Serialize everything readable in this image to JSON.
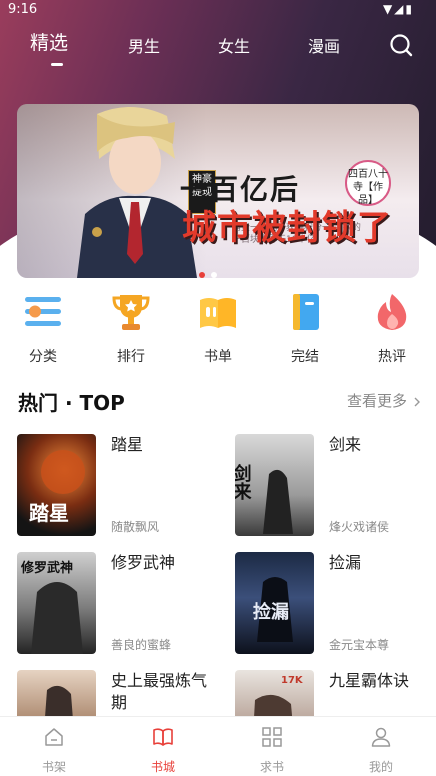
{
  "status": {
    "time": "9:16"
  },
  "tabs": [
    {
      "label": "精选"
    },
    {
      "label": "男生"
    },
    {
      "label": "女生"
    },
    {
      "label": "漫画"
    }
  ],
  "banner": {
    "tagline": "消费一百元，获得积分一百 换的一百块世界干10个亿",
    "badge_left": "神豪提现",
    "title": "一百亿后",
    "subtitle": "城市被封锁了",
    "badge_right": "四百八十寺【作品】"
  },
  "categories": [
    {
      "label": "分类",
      "icon": "list-icon"
    },
    {
      "label": "排行",
      "icon": "trophy-icon"
    },
    {
      "label": "书单",
      "icon": "open-book-icon"
    },
    {
      "label": "完结",
      "icon": "notebook-icon"
    },
    {
      "label": "热评",
      "icon": "flame-icon"
    }
  ],
  "section": {
    "title": "热门 · TOP",
    "more": "查看更多"
  },
  "books": [
    {
      "title": "踏星",
      "author": "随散飘风"
    },
    {
      "title": "剑来",
      "author": "烽火戏诸侯"
    },
    {
      "title": "修罗武神",
      "author": "善良的蜜蜂"
    },
    {
      "title": "捡漏",
      "author": "金元宝本尊"
    },
    {
      "title": "史上最强炼气期",
      "author": ""
    },
    {
      "title": "九星霸体诀",
      "author": ""
    }
  ],
  "covers": [
    {
      "label": "踏星"
    },
    {
      "label": "剑来"
    },
    {
      "label": "修罗武神"
    },
    {
      "label": "捡漏"
    },
    {
      "label": ""
    },
    {
      "label": "17K"
    }
  ],
  "bottom_nav": [
    {
      "label": "书架"
    },
    {
      "label": "书城"
    },
    {
      "label": "求书"
    },
    {
      "label": "我的"
    }
  ],
  "colors": {
    "accent": "#e8403a",
    "inactive": "#999999",
    "banner_dot_active": "#e8403a"
  }
}
